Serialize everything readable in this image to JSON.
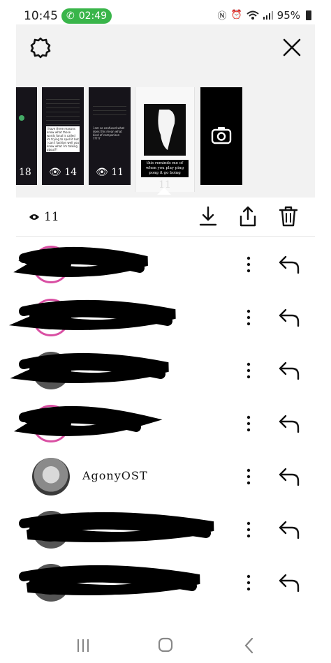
{
  "status_bar": {
    "time": "10:45",
    "call_timer": "02:49",
    "battery": "95%"
  },
  "story_tray": {
    "thumbnails": [
      {
        "views": "18",
        "selected": false
      },
      {
        "views": "14",
        "selected": false,
        "caption": "i have three reasons know what those words fanal is called im trying to spell it but i can't fashion well you know what i'm talking about?!"
      },
      {
        "views": "11",
        "selected": false,
        "caption": "i am so confused what does this mean what kind of comparison ?????"
      },
      {
        "views": "11",
        "selected": true,
        "caption": "this reminds me of when you play ping pong it go boing"
      }
    ]
  },
  "toolbar": {
    "views_count": "11"
  },
  "viewers": [
    {
      "username": "",
      "redacted": true,
      "ring": true
    },
    {
      "username": "",
      "redacted": true,
      "ring": true
    },
    {
      "username": "",
      "redacted": true,
      "ring": false
    },
    {
      "username": "",
      "redacted": true,
      "ring": true
    },
    {
      "username": "AgonyOST",
      "redacted": false,
      "ring": false
    },
    {
      "username": "",
      "redacted": true,
      "ring": false
    },
    {
      "username": "",
      "redacted": true,
      "ring": false
    }
  ],
  "colors": {
    "call_pill": "#39b54a",
    "story_ring": "#d94fa3",
    "tray_bg": "#f2f2f2"
  }
}
